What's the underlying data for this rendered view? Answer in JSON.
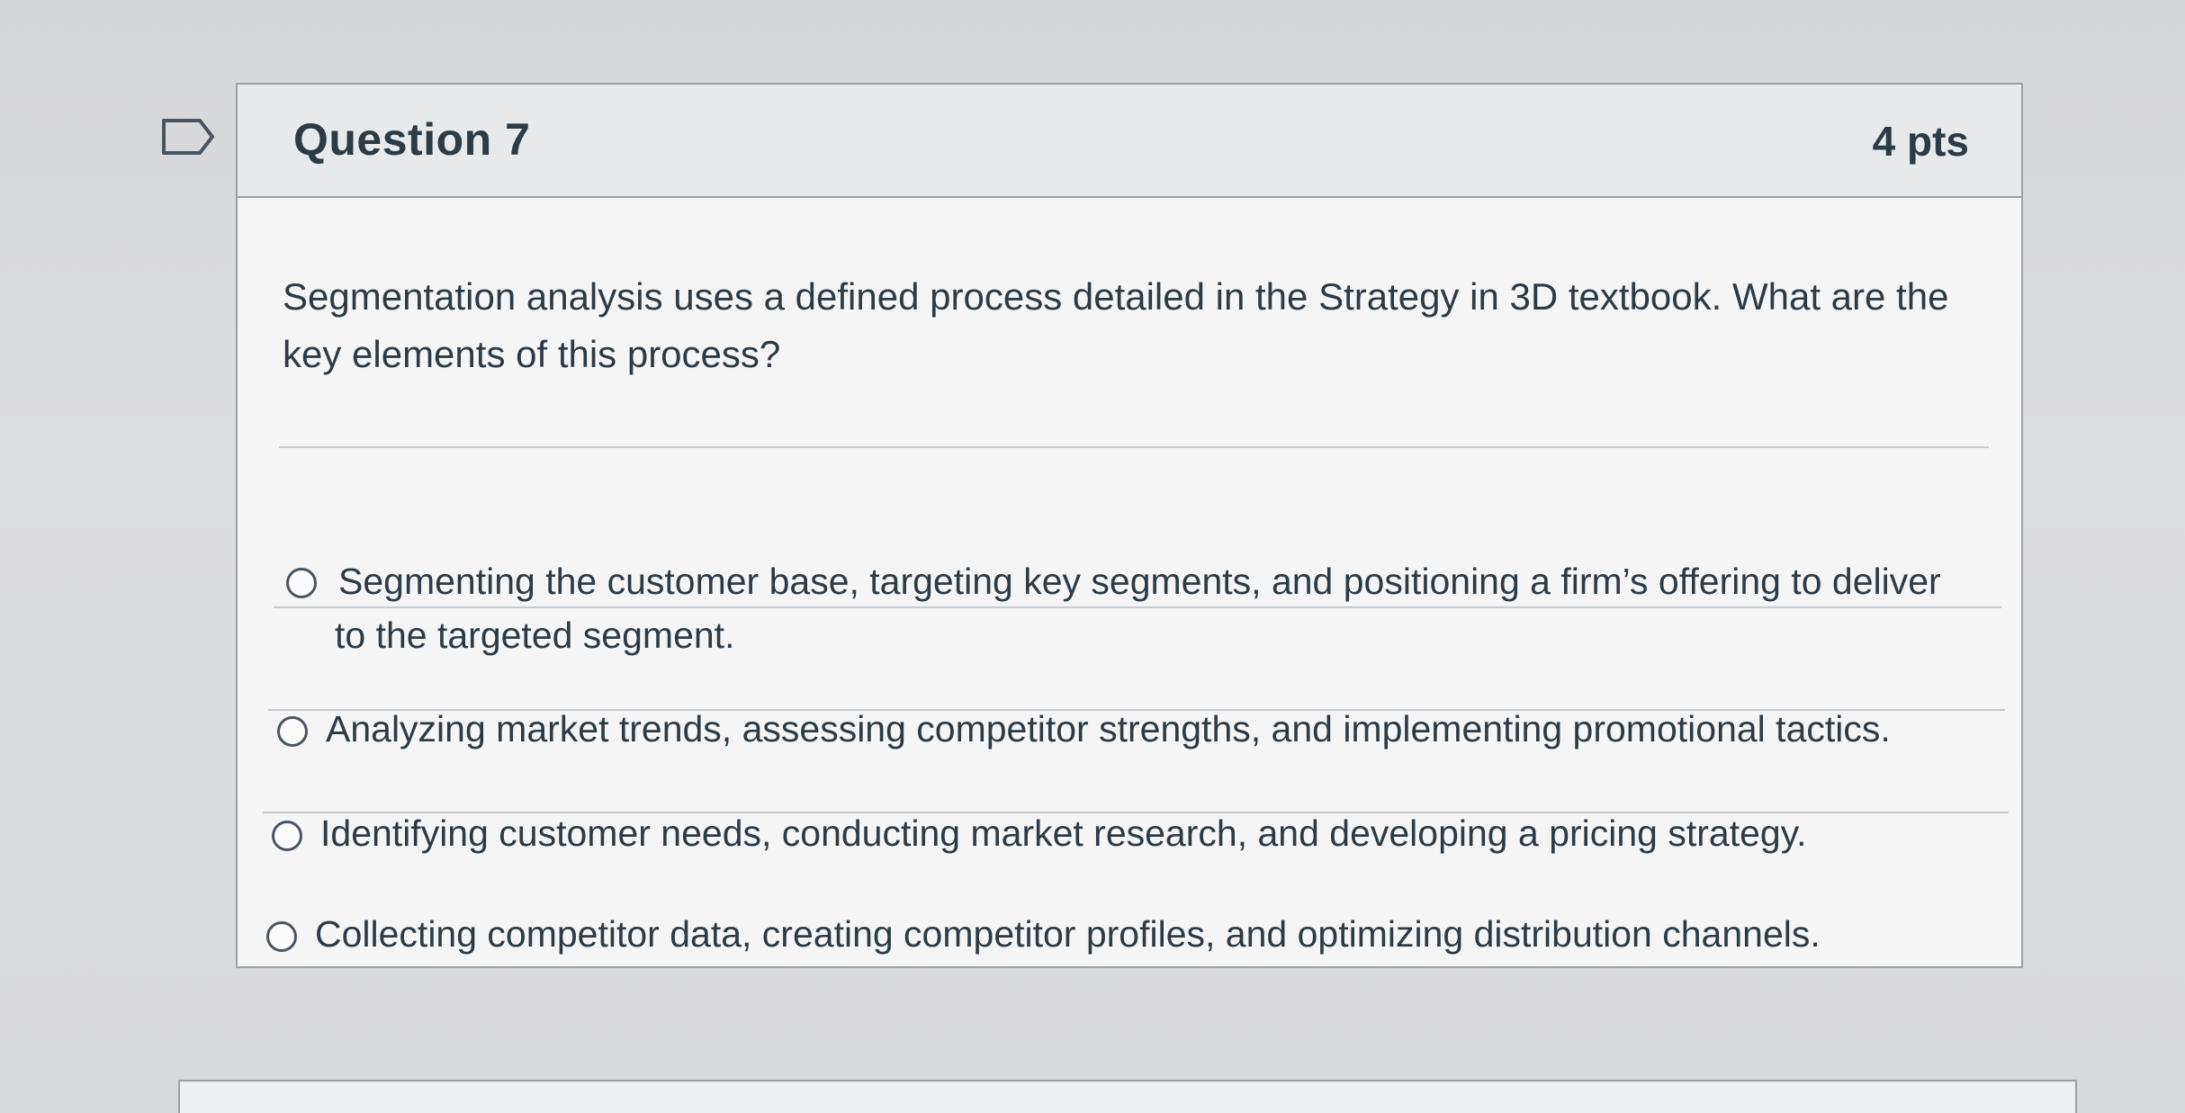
{
  "question": {
    "title": "Question 7",
    "points": "4 pts",
    "text": "Segmentation analysis uses a defined process detailed in the Strategy in 3D textbook. What are the key elements of this process?",
    "flag_icon": "flag-icon"
  },
  "answers": [
    {
      "label": "Segmenting the customer base, targeting key segments, and positioning a firm’s offering to deliver to the targeted segment.",
      "selected": false
    },
    {
      "label": "Analyzing market trends, assessing competitor strengths, and implementing promotional tactics.",
      "selected": false
    },
    {
      "label": "Identifying customer needs, conducting market research, and developing a pricing strategy.",
      "selected": false
    },
    {
      "label": "Collecting competitor data, creating competitor profiles, and optimizing distribution channels.",
      "selected": false
    }
  ]
}
